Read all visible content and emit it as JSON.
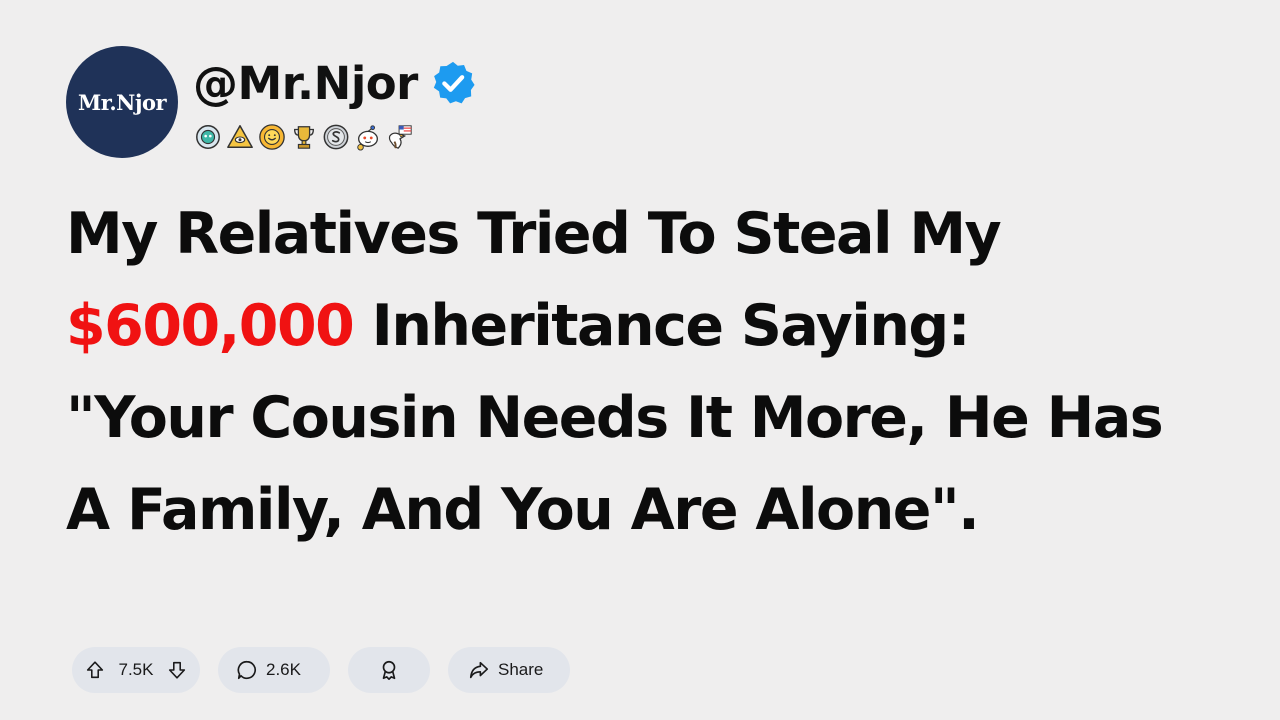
{
  "post": {
    "avatar_text": "Mr.Njor",
    "username": "@Mr.Njor",
    "title_line1": "My Relatives Tried To Steal My",
    "title_amount": "$600,000",
    "title_line2_rest": " Inheritance Saying:",
    "title_line3": "\"Your Cousin Needs It More, He Has",
    "title_line4": "A Family, And You Are Alone\"."
  },
  "badges": [
    "snoo-badge-icon",
    "pyramid-eye-badge-icon",
    "sun-face-badge-icon",
    "trophy-badge-icon",
    "silver-coin-badge-icon",
    "helper-snoo-badge-icon",
    "eagle-flag-badge-icon"
  ],
  "actions": {
    "upvotes": "7.5K",
    "comments": "2.6K",
    "share_label": "Share"
  },
  "colors": {
    "background": "#efeeee",
    "avatar": "#1f3258",
    "verified": "#1d9bf0",
    "amount_highlight": "#f01212",
    "pill_background": "#e2e5eb"
  }
}
